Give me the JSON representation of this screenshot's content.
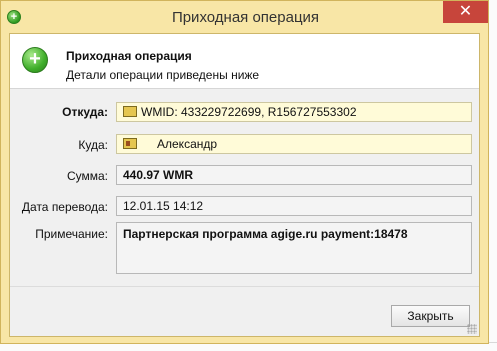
{
  "window": {
    "title": "Приходная операция",
    "close_label": "✕",
    "title_icon": "plus-icon"
  },
  "header": {
    "title": "Приходная операция",
    "subtitle": "Детали операции приведены ниже",
    "icon": "plus-icon"
  },
  "fields": {
    "from": {
      "label": "Откуда:",
      "value": "WMID: 433229722699, R156727553302",
      "icon": "wallet-icon"
    },
    "to": {
      "label": "Куда:",
      "value": "Александр",
      "icon": "contact-card-icon"
    },
    "amount": {
      "label": "Сумма:",
      "value": "440.97 WMR"
    },
    "date": {
      "label": "Дата перевода:",
      "value": "12.01.15 14:12"
    },
    "note": {
      "label": "Примечание:",
      "value": "Партнерская программа agige.ru payment:18478"
    }
  },
  "footer": {
    "close_button_label": "Закрыть"
  },
  "colors": {
    "window_frame": "#f8e6a6",
    "close_button": "#c7453b",
    "field_highlight": "#fffbd8"
  }
}
